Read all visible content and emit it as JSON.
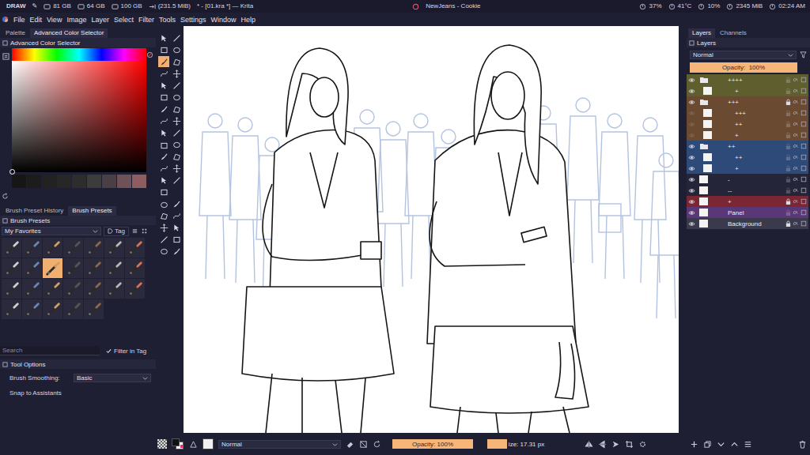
{
  "topbar": {
    "workspace": "DRAW",
    "edit_icon": "✎",
    "disks": [
      "81 GB",
      "64 GB",
      "100 GB"
    ],
    "memory": "(231.5 MiB)",
    "window_title": "* - [01.kra *] — Krita",
    "now_playing": "NewJeans - Cookie",
    "stats": [
      "37%",
      "41°C",
      "10%",
      "2345 MiB",
      "02:24 AM"
    ]
  },
  "menu": [
    "File",
    "Edit",
    "View",
    "Image",
    "Layer",
    "Select",
    "Filter",
    "Tools",
    "Settings",
    "Window",
    "Help"
  ],
  "color_dock": {
    "tabs": [
      {
        "label": "Palette",
        "selected": false
      },
      {
        "label": "Advanced Color Selector",
        "selected": true
      }
    ],
    "title": "Advanced Color Selector",
    "recent_colors": [
      "#161616",
      "#1c1c1c",
      "#222222",
      "#272727",
      "#2d2d2d",
      "#3c3c3c",
      "#4a3f44",
      "#6e5257",
      "#8e5d60"
    ]
  },
  "brush_dock": {
    "tabs": [
      {
        "label": "Brush Preset History",
        "selected": false
      },
      {
        "label": "Brush Presets",
        "selected": true
      }
    ],
    "title": "Brush Presets",
    "tag_group": "My Favorites",
    "tag_button": "Tag",
    "presets": [
      {
        "selected": false
      },
      {
        "selected": false
      },
      {
        "selected": false
      },
      {
        "selected": false
      },
      {
        "selected": false
      },
      {
        "selected": false
      },
      {
        "selected": false
      },
      {
        "selected": false
      },
      {
        "selected": false
      },
      {
        "selected": true
      },
      {
        "selected": false
      },
      {
        "selected": false
      },
      {
        "selected": false
      },
      {
        "selected": false
      },
      {
        "selected": false
      },
      {
        "selected": false
      },
      {
        "selected": false
      },
      {
        "selected": false
      },
      {
        "selected": false
      },
      {
        "selected": false
      },
      {
        "selected": false
      },
      {
        "selected": false
      },
      {
        "selected": false
      },
      {
        "selected": false
      },
      {
        "selected": false
      },
      {
        "selected": false
      }
    ],
    "search_placeholder": "Search",
    "filter_in_tag": {
      "label": "Filter in Tag",
      "checked": true
    }
  },
  "tool_options": {
    "title": "Tool Options",
    "smoothing_label": "Brush Smoothing:",
    "smoothing_value": "Basic",
    "snap_label": "Snap to Assistants"
  },
  "toolbox": [
    {
      "selected": false
    },
    {
      "selected": false
    },
    {
      "selected": false
    },
    {
      "selected": false
    },
    {
      "selected": true
    },
    {
      "selected": false
    },
    {
      "selected": false
    },
    {
      "selected": false
    },
    {
      "selected": false
    },
    {
      "selected": false
    },
    {
      "selected": false
    },
    {
      "selected": false
    },
    {
      "selected": false
    },
    {
      "selected": false
    },
    {
      "selected": false
    },
    {
      "selected": false
    },
    {
      "selected": false
    },
    {
      "selected": false
    },
    {
      "selected": false
    },
    {
      "selected": false
    },
    {
      "selected": false
    },
    {
      "selected": false
    },
    {
      "selected": false
    },
    {
      "selected": false
    },
    {
      "selected": false
    },
    {
      "selected": false
    },
    {
      "selected": false
    },
    {
      "selected": false
    },
    {
      "selected": false
    },
    {
      "selected": false
    },
    {
      "selected": false
    },
    {
      "selected": false
    },
    {
      "selected": false
    },
    {
      "selected": false
    },
    {
      "selected": false
    },
    {
      "selected": false
    },
    {
      "selected": false
    }
  ],
  "layers_dock": {
    "tabs": [
      {
        "label": "Layers",
        "selected": true
      },
      {
        "label": "Channels",
        "selected": false
      }
    ],
    "title": "Layers",
    "blend_mode": "Normal",
    "opacity": "Opacity:  100%",
    "layers": [
      {
        "name": "++++",
        "group": true,
        "depth": 0,
        "visible": true,
        "locked": false,
        "color": "#5f5e2e"
      },
      {
        "name": "+",
        "group": false,
        "depth": 1,
        "visible": true,
        "locked": false,
        "color": "#5f5e2e"
      },
      {
        "name": "+++",
        "group": true,
        "depth": 0,
        "visible": true,
        "locked": true,
        "color": "#6a4a30"
      },
      {
        "name": "+++",
        "group": false,
        "depth": 1,
        "visible": false,
        "locked": false,
        "color": "#6a4a30"
      },
      {
        "name": "++",
        "group": false,
        "depth": 1,
        "visible": false,
        "locked": false,
        "color": "#6a4a30"
      },
      {
        "name": "+",
        "group": false,
        "depth": 1,
        "visible": false,
        "locked": false,
        "color": "#6a4a30"
      },
      {
        "name": "++",
        "group": true,
        "depth": 0,
        "visible": true,
        "locked": false,
        "color": "#2e4a78"
      },
      {
        "name": "++",
        "group": false,
        "depth": 1,
        "visible": true,
        "locked": false,
        "color": "#2e4a78"
      },
      {
        "name": "+",
        "group": false,
        "depth": 1,
        "visible": true,
        "locked": false,
        "color": "#2e4a78"
      },
      {
        "name": "-",
        "group": false,
        "depth": 0,
        "visible": true,
        "locked": false,
        "color": "#25253a"
      },
      {
        "name": "--",
        "group": false,
        "depth": 0,
        "visible": true,
        "locked": false,
        "color": "#25253a"
      },
      {
        "name": "+",
        "group": false,
        "depth": 0,
        "visible": true,
        "locked": true,
        "color": "#7a2633"
      },
      {
        "name": "Panel",
        "group": false,
        "depth": 0,
        "visible": true,
        "locked": false,
        "color": "#5a3878"
      },
      {
        "name": "Background",
        "group": false,
        "depth": 0,
        "visible": true,
        "locked": true,
        "color": "#3a3a4c"
      }
    ]
  },
  "bottom_bar": {
    "foreground": "#111111",
    "background": "#ffffff",
    "blend_mode": "Normal",
    "opacity": "Opacity: 100%",
    "opacity_level": 1,
    "size": "ize: 17.31 px",
    "size_level": 0.22
  }
}
